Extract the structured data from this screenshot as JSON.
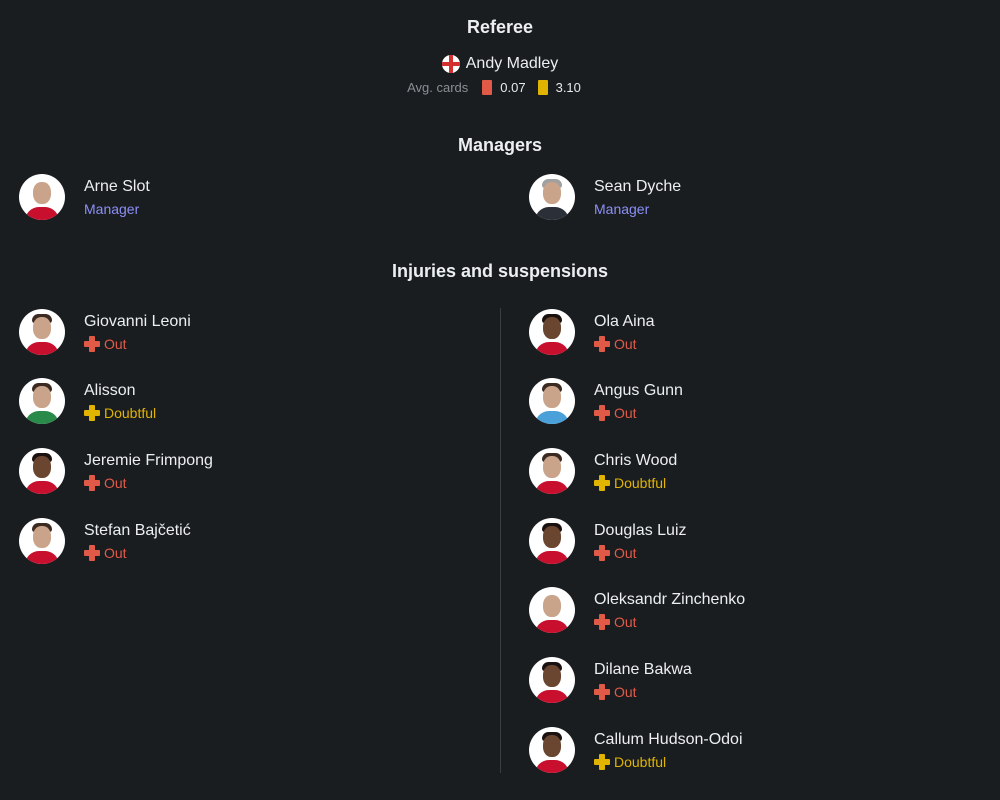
{
  "referee": {
    "section_title": "Referee",
    "name": "Andy Madley",
    "avg_cards_label": "Avg. cards",
    "red_avg": "0.07",
    "yellow_avg": "3.10"
  },
  "managers": {
    "section_title": "Managers",
    "home": {
      "name": "Arne Slot",
      "role": "Manager"
    },
    "away": {
      "name": "Sean Dyche",
      "role": "Manager"
    }
  },
  "injuries": {
    "section_title": "Injuries and suspensions",
    "home": [
      {
        "name": "Giovanni Leoni",
        "status": "Out"
      },
      {
        "name": "Alisson",
        "status": "Doubtful"
      },
      {
        "name": "Jeremie Frimpong",
        "status": "Out"
      },
      {
        "name": "Stefan Bajčetić",
        "status": "Out"
      }
    ],
    "away": [
      {
        "name": "Ola Aina",
        "status": "Out"
      },
      {
        "name": "Angus Gunn",
        "status": "Out"
      },
      {
        "name": "Chris Wood",
        "status": "Doubtful"
      },
      {
        "name": "Douglas Luiz",
        "status": "Out"
      },
      {
        "name": "Oleksandr Zinchenko",
        "status": "Out"
      },
      {
        "name": "Dilane Bakwa",
        "status": "Out"
      },
      {
        "name": "Callum Hudson-Odoi",
        "status": "Doubtful"
      }
    ]
  },
  "colors": {
    "background": "#1a1d20",
    "out": "#e05a47",
    "doubtful": "#e0b400",
    "manager_role": "#8b8ff5"
  },
  "icons": {
    "flag": "england-flag-icon",
    "status": "plus-cross-icon"
  }
}
